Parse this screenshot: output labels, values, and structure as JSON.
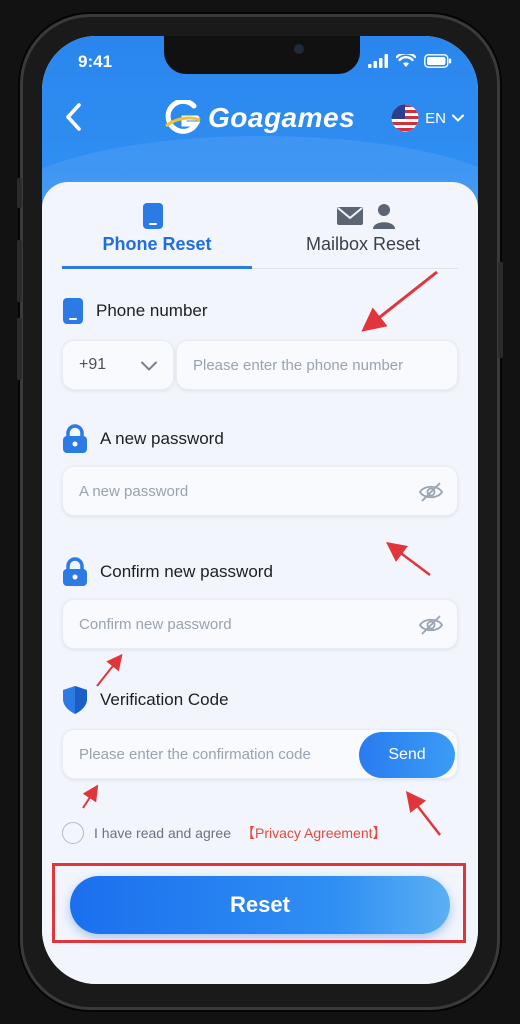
{
  "status_bar": {
    "time": "9:41"
  },
  "header": {
    "back_icon": "chevron-left-icon",
    "logo_text": "Goagames",
    "language": "EN"
  },
  "tabs": [
    {
      "label": "Phone Reset",
      "icon": "phone-icon",
      "active": true
    },
    {
      "label": "Mailbox Reset",
      "icon": "mail-user-icon",
      "active": false
    }
  ],
  "form": {
    "phone": {
      "label": "Phone number",
      "country_code": "+91",
      "placeholder": "Please enter the phone number"
    },
    "new_password": {
      "label": "A new password",
      "placeholder": "A new password"
    },
    "confirm_password": {
      "label": "Confirm new password",
      "placeholder": "Confirm new password"
    },
    "verification": {
      "label": "Verification Code",
      "placeholder": "Please enter the confirmation code",
      "send_label": "Send"
    },
    "agreement": {
      "text": "I have read and agree",
      "link": "【Privacy Agreement】"
    },
    "submit_label": "Reset"
  },
  "colors": {
    "accent": "#2c7be5",
    "annotation": "#e0363b",
    "privacy_link": "#e8473c"
  }
}
